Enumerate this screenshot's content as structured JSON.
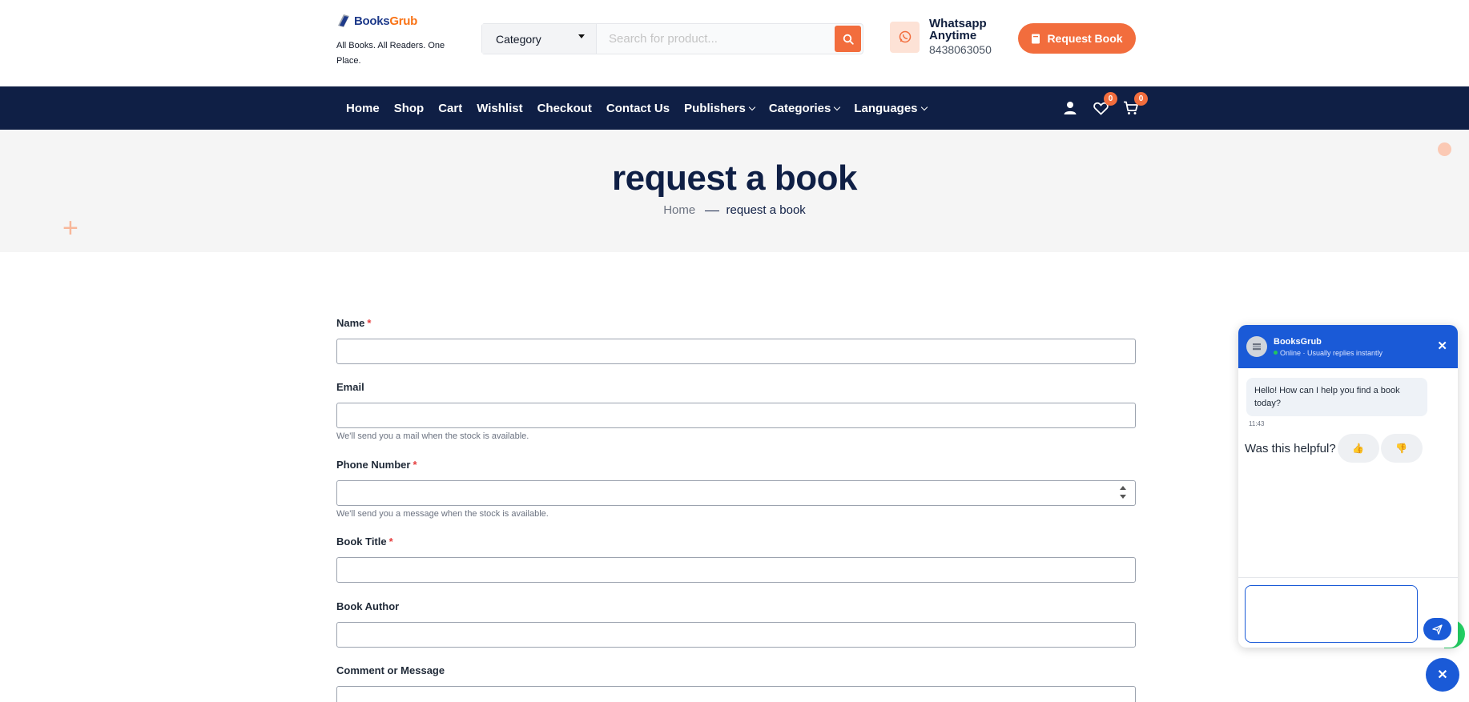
{
  "brand": {
    "logo_part1": "Books",
    "logo_part2": "Grub",
    "tagline": "All Books. All Readers. One Place."
  },
  "search": {
    "category_label": "Category",
    "placeholder": "Search for product..."
  },
  "whatsapp": {
    "line1": "Whatsapp",
    "line2": "Anytime",
    "phone": "8438063050"
  },
  "header": {
    "request_button": "Request Book"
  },
  "nav": {
    "items": [
      {
        "label": "Home"
      },
      {
        "label": "Shop"
      },
      {
        "label": "Cart"
      },
      {
        "label": "Wishlist"
      },
      {
        "label": "Checkout"
      },
      {
        "label": "Contact Us"
      },
      {
        "label": "Publishers"
      },
      {
        "label": "Categories"
      },
      {
        "label": "Languages"
      }
    ],
    "wishlist_count": "0",
    "cart_count": "0"
  },
  "hero": {
    "title": "request a book",
    "breadcrumb_home": "Home",
    "breadcrumb_current": "request a book"
  },
  "form": {
    "name_label": "Name",
    "email_label": "Email",
    "email_help": "We'll send you a mail when the stock is available.",
    "phone_label": "Phone Number",
    "phone_help": "We'll send you a message when the stock is available.",
    "title_label": "Book Title",
    "author_label": "Book Author",
    "comment_label": "Comment or Message",
    "required_mark": "*"
  },
  "chat": {
    "name": "BooksGrub",
    "status": "Online · Usually replies instantly",
    "close_glyph": "✕",
    "message": "Hello! How can I help you find a book today?",
    "time": "11:43",
    "helpful_question": "Was this helpful?",
    "thumbs_up": "👍",
    "thumbs_down": "👎",
    "fab_glyph": "✕"
  },
  "colors": {
    "accent": "#f26d3d",
    "navy": "#0f1f45",
    "chat_blue": "#1a5ad7"
  }
}
